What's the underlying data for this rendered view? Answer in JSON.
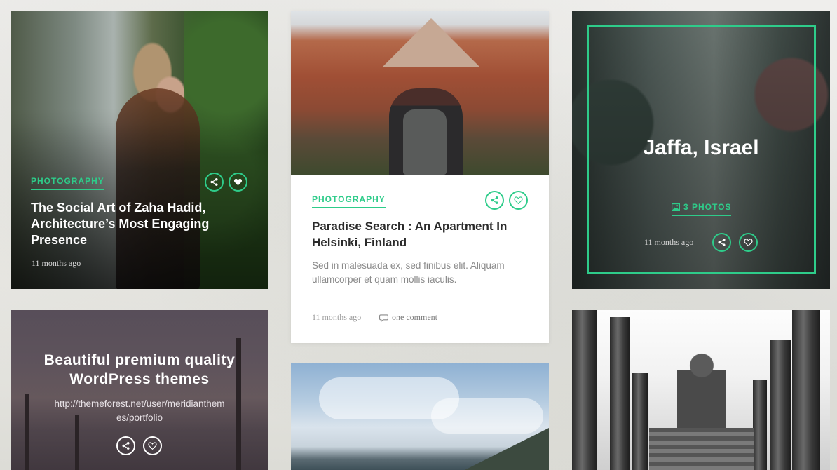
{
  "colors": {
    "accent": "#2ecc8a"
  },
  "card1": {
    "category": "PHOTOGRAPHY",
    "title": "The Social Art of Zaha Hadid, Architecture’s Most Engaging Presence",
    "date": "11 months ago",
    "icons": [
      "share-icon",
      "heart-icon"
    ]
  },
  "card2": {
    "category": "PHOTOGRAPHY",
    "title": "Paradise Search : An Apartment In Helsinki, Finland",
    "excerpt": "Sed in malesuada ex, sed finibus elit. Aliquam ullamcorper et quam mollis iaculis.",
    "date": "11 months ago",
    "comments": "one comment",
    "icons": [
      "share-icon",
      "heart-icon",
      "comment-icon"
    ]
  },
  "card3": {
    "title": "Jaffa, Israel",
    "photos": "3 PHOTOS",
    "date": "11 months ago",
    "icons": [
      "image-icon",
      "share-icon",
      "heart-icon"
    ]
  },
  "card4": {
    "title_line1": "Beautiful premium quality",
    "title_line2": "WordPress themes",
    "url": "http://themeforest.net/user/meridianthemes/portfolio",
    "icons": [
      "share-icon",
      "heart-icon"
    ]
  }
}
